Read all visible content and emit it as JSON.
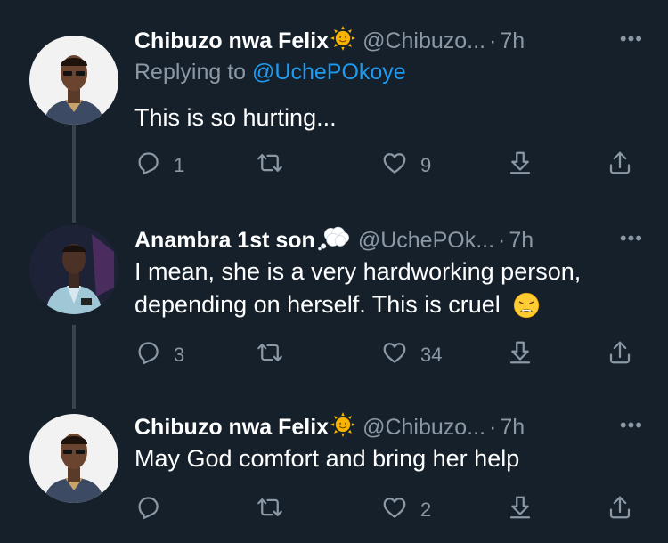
{
  "tweets": [
    {
      "name": "Chibuzo nwa Felix",
      "handle": "@Chibuzo...",
      "dot": "·",
      "time": "7h",
      "more": "•••",
      "replying_prefix": "Replying to ",
      "replying_mention": "@UchePOkoye",
      "text": "This is so hurting...",
      "reply_count": "1",
      "retweet_count": "",
      "like_count": "9"
    },
    {
      "name": "Anambra 1st son",
      "handle": "@UchePOk...",
      "dot": "·",
      "time": "7h",
      "more": "•••",
      "text_line1": "I mean, she is a very hardworking person,",
      "text_line2": "depending on herself. This is cruel",
      "reply_count": "3",
      "retweet_count": "",
      "like_count": "34"
    },
    {
      "name": "Chibuzo nwa Felix",
      "handle": "@Chibuzo...",
      "dot": "·",
      "time": "7h",
      "more": "•••",
      "text": "May God comfort and bring her help",
      "reply_count": "",
      "retweet_count": "",
      "like_count": "2"
    }
  ],
  "icons": {
    "name_badge_1": "sun-emoji-icon",
    "name_badge_2": "thought-bubble-emoji-icon",
    "text_emoji": "weary-face-emoji-icon"
  },
  "colors": {
    "background": "#15202b",
    "secondary_text": "#8b98a5",
    "mention": "#1d9bf0",
    "thread_line": "#38444d"
  }
}
